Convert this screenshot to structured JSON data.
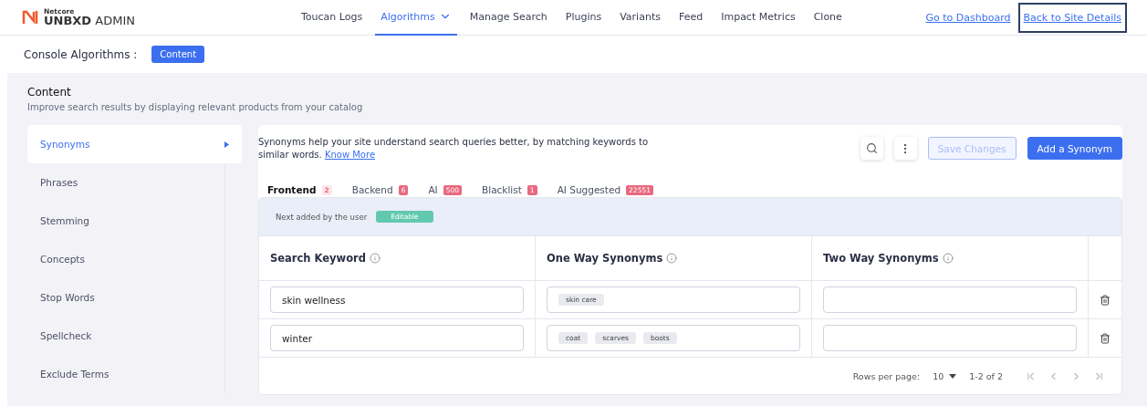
{
  "brand": {
    "small": "Netcore",
    "name": "UNBXD",
    "suffix": "ADMIN"
  },
  "nav": [
    {
      "label": "Toucan Logs",
      "selected": false,
      "dropdown": false
    },
    {
      "label": "Algorithms",
      "selected": true,
      "dropdown": true
    },
    {
      "label": "Manage Search",
      "selected": false,
      "dropdown": false
    },
    {
      "label": "Plugins",
      "selected": false,
      "dropdown": false
    },
    {
      "label": "Variants",
      "selected": false,
      "dropdown": false
    },
    {
      "label": "Feed",
      "selected": false,
      "dropdown": false
    },
    {
      "label": "Impact Metrics",
      "selected": false,
      "dropdown": false
    },
    {
      "label": "Clone",
      "selected": false,
      "dropdown": false
    }
  ],
  "header_links": [
    {
      "label": "Go to Dashboard",
      "focused": false
    },
    {
      "label": "Back to Site Details",
      "focused": true
    }
  ],
  "breadcrumb": {
    "label": "Console Algorithms :",
    "chip": "Content"
  },
  "section": {
    "title": "Content",
    "subtitle": "Improve search results by displaying relevant products from your catalog"
  },
  "sidebar": [
    {
      "label": "Synonyms",
      "selected": true
    },
    {
      "label": "Phrases",
      "selected": false
    },
    {
      "label": "Stemming",
      "selected": false
    },
    {
      "label": "Concepts",
      "selected": false
    },
    {
      "label": "Stop Words",
      "selected": false
    },
    {
      "label": "Spellcheck",
      "selected": false
    },
    {
      "label": "Exclude Terms",
      "selected": false
    }
  ],
  "intro": {
    "text": "Synonyms help your site understand search queries better, by matching keywords to similar words.",
    "link": "Know More"
  },
  "actions": [
    {
      "label": "Save Changes",
      "disabled": true
    },
    {
      "label": "Add a Synonym",
      "disabled": false
    }
  ],
  "tabs": [
    {
      "label": "Frontend",
      "count": "2",
      "selected": true
    },
    {
      "label": "Backend",
      "count": "6",
      "selected": false
    },
    {
      "label": "AI",
      "count": "500",
      "selected": false
    },
    {
      "label": "Blacklist",
      "count": "1",
      "selected": false
    },
    {
      "label": "AI Suggested",
      "count": "22551",
      "selected": false
    }
  ],
  "notice": {
    "text": "Next added by the user",
    "tag": "Editable"
  },
  "table": {
    "columns": [
      "Search Keyword",
      "One Way Synonyms",
      "Two Way Synonyms"
    ],
    "rows": [
      {
        "keyword": "skin wellness",
        "one_way": [
          "skin care"
        ],
        "two_way": []
      },
      {
        "keyword": "winter",
        "one_way": [
          "coat",
          "scarves",
          "boots"
        ],
        "two_way": []
      }
    ]
  },
  "pagination": {
    "label": "Rows per page:",
    "per_page": "10",
    "range": "1-2 of 2"
  }
}
